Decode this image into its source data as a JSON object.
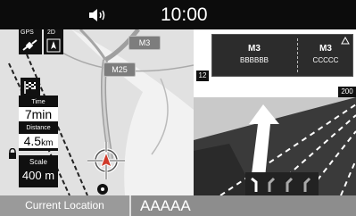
{
  "status_bar": {
    "clock": "10:00",
    "volume_icon": "speaker-volume-icon"
  },
  "map": {
    "road_labels": [
      "M3",
      "M25"
    ],
    "gps_label": "GPS",
    "view_mode_label": "2D",
    "time": {
      "caption": "Time",
      "value": "7min"
    },
    "distance": {
      "caption": "Distance",
      "value": "4.5",
      "unit": "km"
    },
    "scale": {
      "caption": "Scale",
      "value": "400 m"
    }
  },
  "junction": {
    "sign": [
      {
        "road": "M3",
        "destination": "BBBBBB"
      },
      {
        "road": "M3",
        "destination": "CCCCC"
      }
    ],
    "distance_left": "12",
    "distance_right": "200"
  },
  "bottom_bar": {
    "current_location_label": "Current Location",
    "street_name": "AAAAA"
  },
  "colors": {
    "map_bg": "#e1e1e1",
    "bottom_bar": "#8d8d8d",
    "status_bar": "#0c0c0c"
  }
}
